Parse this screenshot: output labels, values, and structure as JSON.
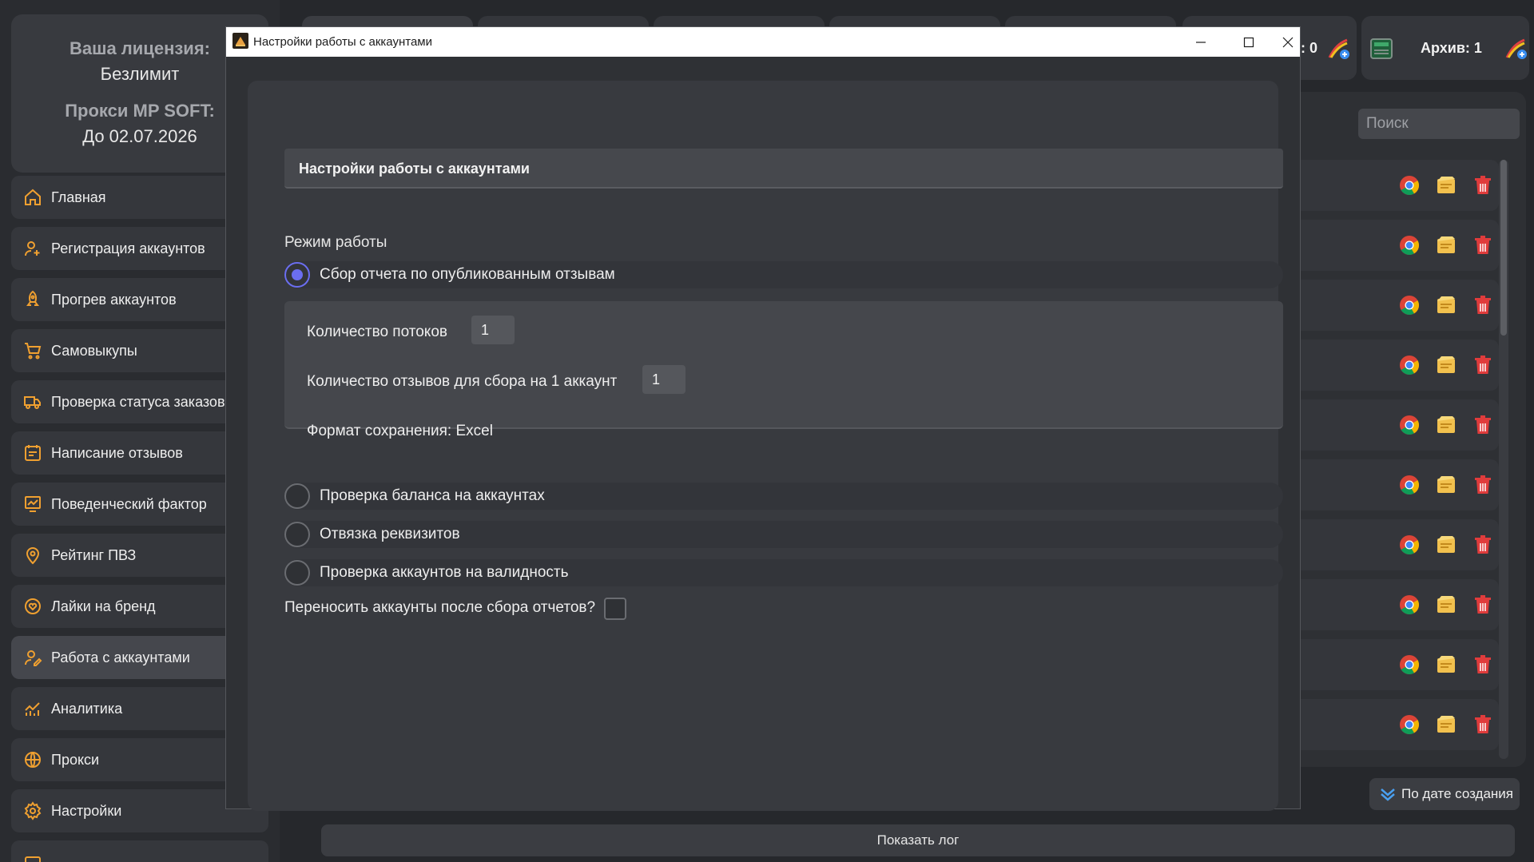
{
  "license": {
    "label": "Ваша лицензия:",
    "value": "Безлимит",
    "proxy_label": "Прокси MP SOFT:",
    "proxy_value": "До 02.07.2026"
  },
  "sidebar": {
    "items": [
      {
        "label": "Главная",
        "icon": "home-icon"
      },
      {
        "label": "Регистрация аккаунтов",
        "icon": "user-add-icon"
      },
      {
        "label": "Прогрев аккаунтов",
        "icon": "rocket-icon"
      },
      {
        "label": "Самовыкупы",
        "icon": "cart-icon"
      },
      {
        "label": "Проверка статуса заказов",
        "icon": "truck-icon"
      },
      {
        "label": "Написание отзывов",
        "icon": "review-icon"
      },
      {
        "label": "Поведенческий фактор",
        "icon": "chart-user-icon"
      },
      {
        "label": "Рейтинг ПВЗ",
        "icon": "location-pin-icon"
      },
      {
        "label": "Лайки на бренд",
        "icon": "heart-icon"
      },
      {
        "label": "Работа с аккаунтами",
        "icon": "user-edit-icon",
        "active": true
      },
      {
        "label": "Аналитика",
        "icon": "analytics-icon"
      },
      {
        "label": "Прокси",
        "icon": "globe-icon"
      },
      {
        "label": "Настройки",
        "icon": "gear-icon"
      }
    ]
  },
  "header": {
    "partial_count": ": 0",
    "archive_label": "Архив: 1"
  },
  "search": {
    "placeholder": "Поиск"
  },
  "sort": {
    "label": "По дате создания"
  },
  "log": {
    "label": "Показать лог"
  },
  "modal": {
    "window_title": "Настройки работы с аккаунтами",
    "header": "Настройки работы с аккаунтами",
    "mode_label": "Режим работы",
    "options": [
      {
        "label": "Сбор отчета по опубликованным отзывам",
        "checked": true
      },
      {
        "label": "Проверка баланса на аккаунтах",
        "checked": false
      },
      {
        "label": "Отвязка реквизитов",
        "checked": false
      },
      {
        "label": "Проверка аккаунтов на валидность",
        "checked": false
      }
    ],
    "threads_label": "Количество потоков",
    "threads_value": "1",
    "reviews_label": "Количество отзывов для сбора на 1 аккаунт",
    "reviews_value": "1",
    "format_label": "Формат сохранения: Excel",
    "transfer_label": "Переносить аккаунты после сбора отчетов?",
    "transfer_checked": false
  },
  "colors": {
    "accent": "#6b6ef0",
    "icon_orange": "#f0a030",
    "delete_red": "#e03c3c"
  }
}
